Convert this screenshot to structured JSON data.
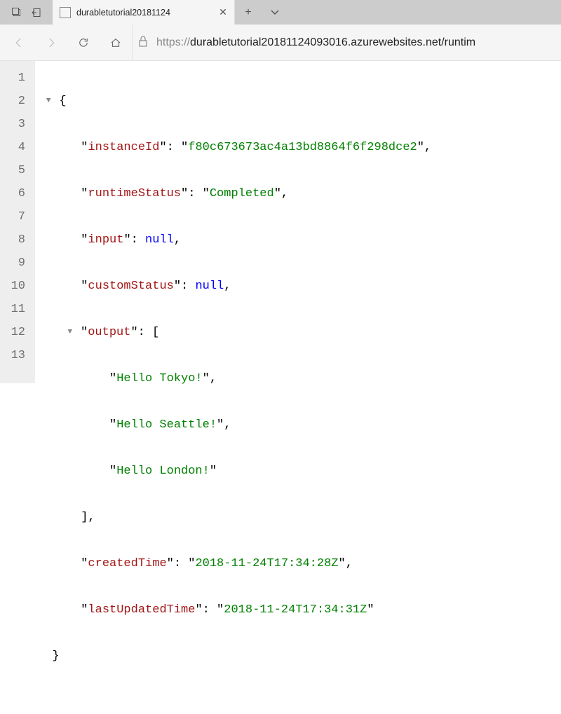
{
  "tab": {
    "title": "durabletutorial20181124"
  },
  "url": {
    "scheme": "https://",
    "display": "durabletutorial20181124093016.azurewebsites.net/runtim"
  },
  "json": {
    "keys": {
      "instanceId": "instanceId",
      "runtimeStatus": "runtimeStatus",
      "input": "input",
      "customStatus": "customStatus",
      "output": "output",
      "createdTime": "createdTime",
      "lastUpdatedTime": "lastUpdatedTime"
    },
    "values": {
      "instanceId": "f80c673673ac4a13bd8864f6f298dce2",
      "runtimeStatus": "Completed",
      "input": "null",
      "customStatus": "null",
      "out0": "Hello Tokyo!",
      "out1": "Hello Seattle!",
      "out2": "Hello London!",
      "createdTime": "2018-11-24T17:34:28Z",
      "lastUpdatedTime": "2018-11-24T17:34:31Z"
    }
  },
  "lines": [
    "1",
    "2",
    "3",
    "4",
    "5",
    "6",
    "7",
    "8",
    "9",
    "10",
    "11",
    "12",
    "13"
  ]
}
